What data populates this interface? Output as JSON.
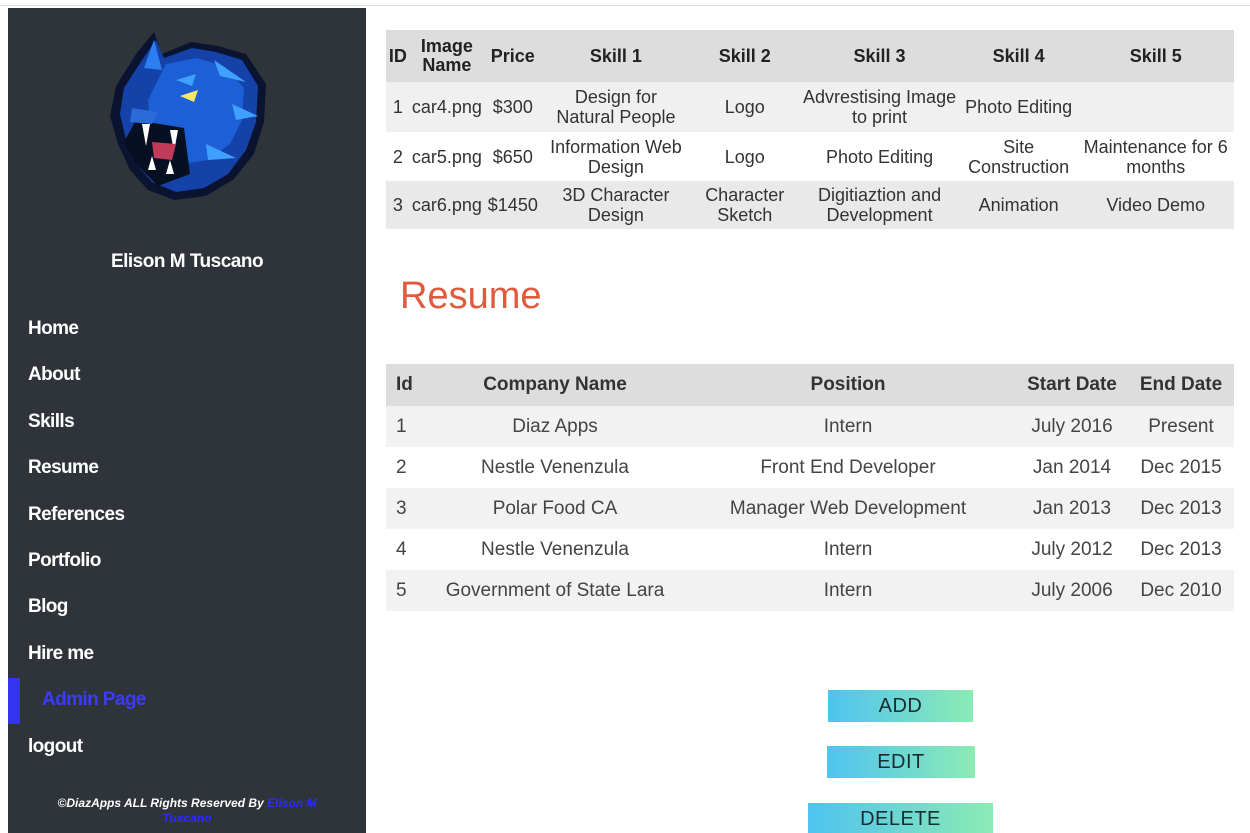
{
  "sidebar": {
    "profile_name": "Elison M Tuscano",
    "logo_icon": "panther-logo-icon",
    "nav": [
      {
        "label": "Home"
      },
      {
        "label": "About"
      },
      {
        "label": "Skills"
      },
      {
        "label": "Resume"
      },
      {
        "label": "References"
      },
      {
        "label": "Portfolio"
      },
      {
        "label": "Blog"
      },
      {
        "label": "Hire me"
      },
      {
        "label": "Admin Page"
      },
      {
        "label": "logout"
      }
    ],
    "active_item": "Admin Page",
    "footer_text": "©DiazApps ALL Rights Reserved By ",
    "footer_link": "Elison M Tuscano"
  },
  "portfolio_table": {
    "headers": [
      "ID",
      "Image Name",
      "Price",
      "Skill 1",
      "Skill 2",
      "Skill 3",
      "Skill 4",
      "Skill 5"
    ],
    "rows": [
      [
        "1",
        "car4.png",
        "$300",
        "Design for Natural People",
        "Logo",
        "Advrestising Image to print",
        "Photo Editing",
        ""
      ],
      [
        "2",
        "car5.png",
        "$650",
        "Information Web Design",
        "Logo",
        "Photo Editing",
        "Site Construction",
        "Maintenance for 6 months"
      ],
      [
        "3",
        "car6.png",
        "$1450",
        "3D Character Design",
        "Character Sketch",
        "Digitiaztion and Development",
        "Animation",
        "Video Demo"
      ]
    ]
  },
  "resume": {
    "title": "Resume",
    "headers": [
      "Id",
      "Company Name",
      "Position",
      "Start Date",
      "End Date"
    ],
    "rows": [
      [
        "1",
        "Diaz Apps",
        "Intern",
        "July 2016",
        "Present"
      ],
      [
        "2",
        "Nestle Venenzula",
        "Front End Developer",
        "Jan 2014",
        "Dec 2015"
      ],
      [
        "3",
        "Polar Food CA",
        "Manager Web Development",
        "Jan 2013",
        "Dec 2013"
      ],
      [
        "4",
        "Nestle Venenzula",
        "Intern",
        "July 2012",
        "Dec 2013"
      ],
      [
        "5",
        "Government of State Lara",
        "Intern",
        "July 2006",
        "Dec 2010"
      ]
    ]
  },
  "buttons": {
    "add": "ADD",
    "edit": "EDIT",
    "delete": "DELETE"
  },
  "colors": {
    "sidebar_bg": "#2f343b",
    "accent_active": "#3434f0",
    "title_color": "#e05a3e",
    "button_gradient_start": "#4ec3f0",
    "button_gradient_end": "#8cebb4"
  }
}
